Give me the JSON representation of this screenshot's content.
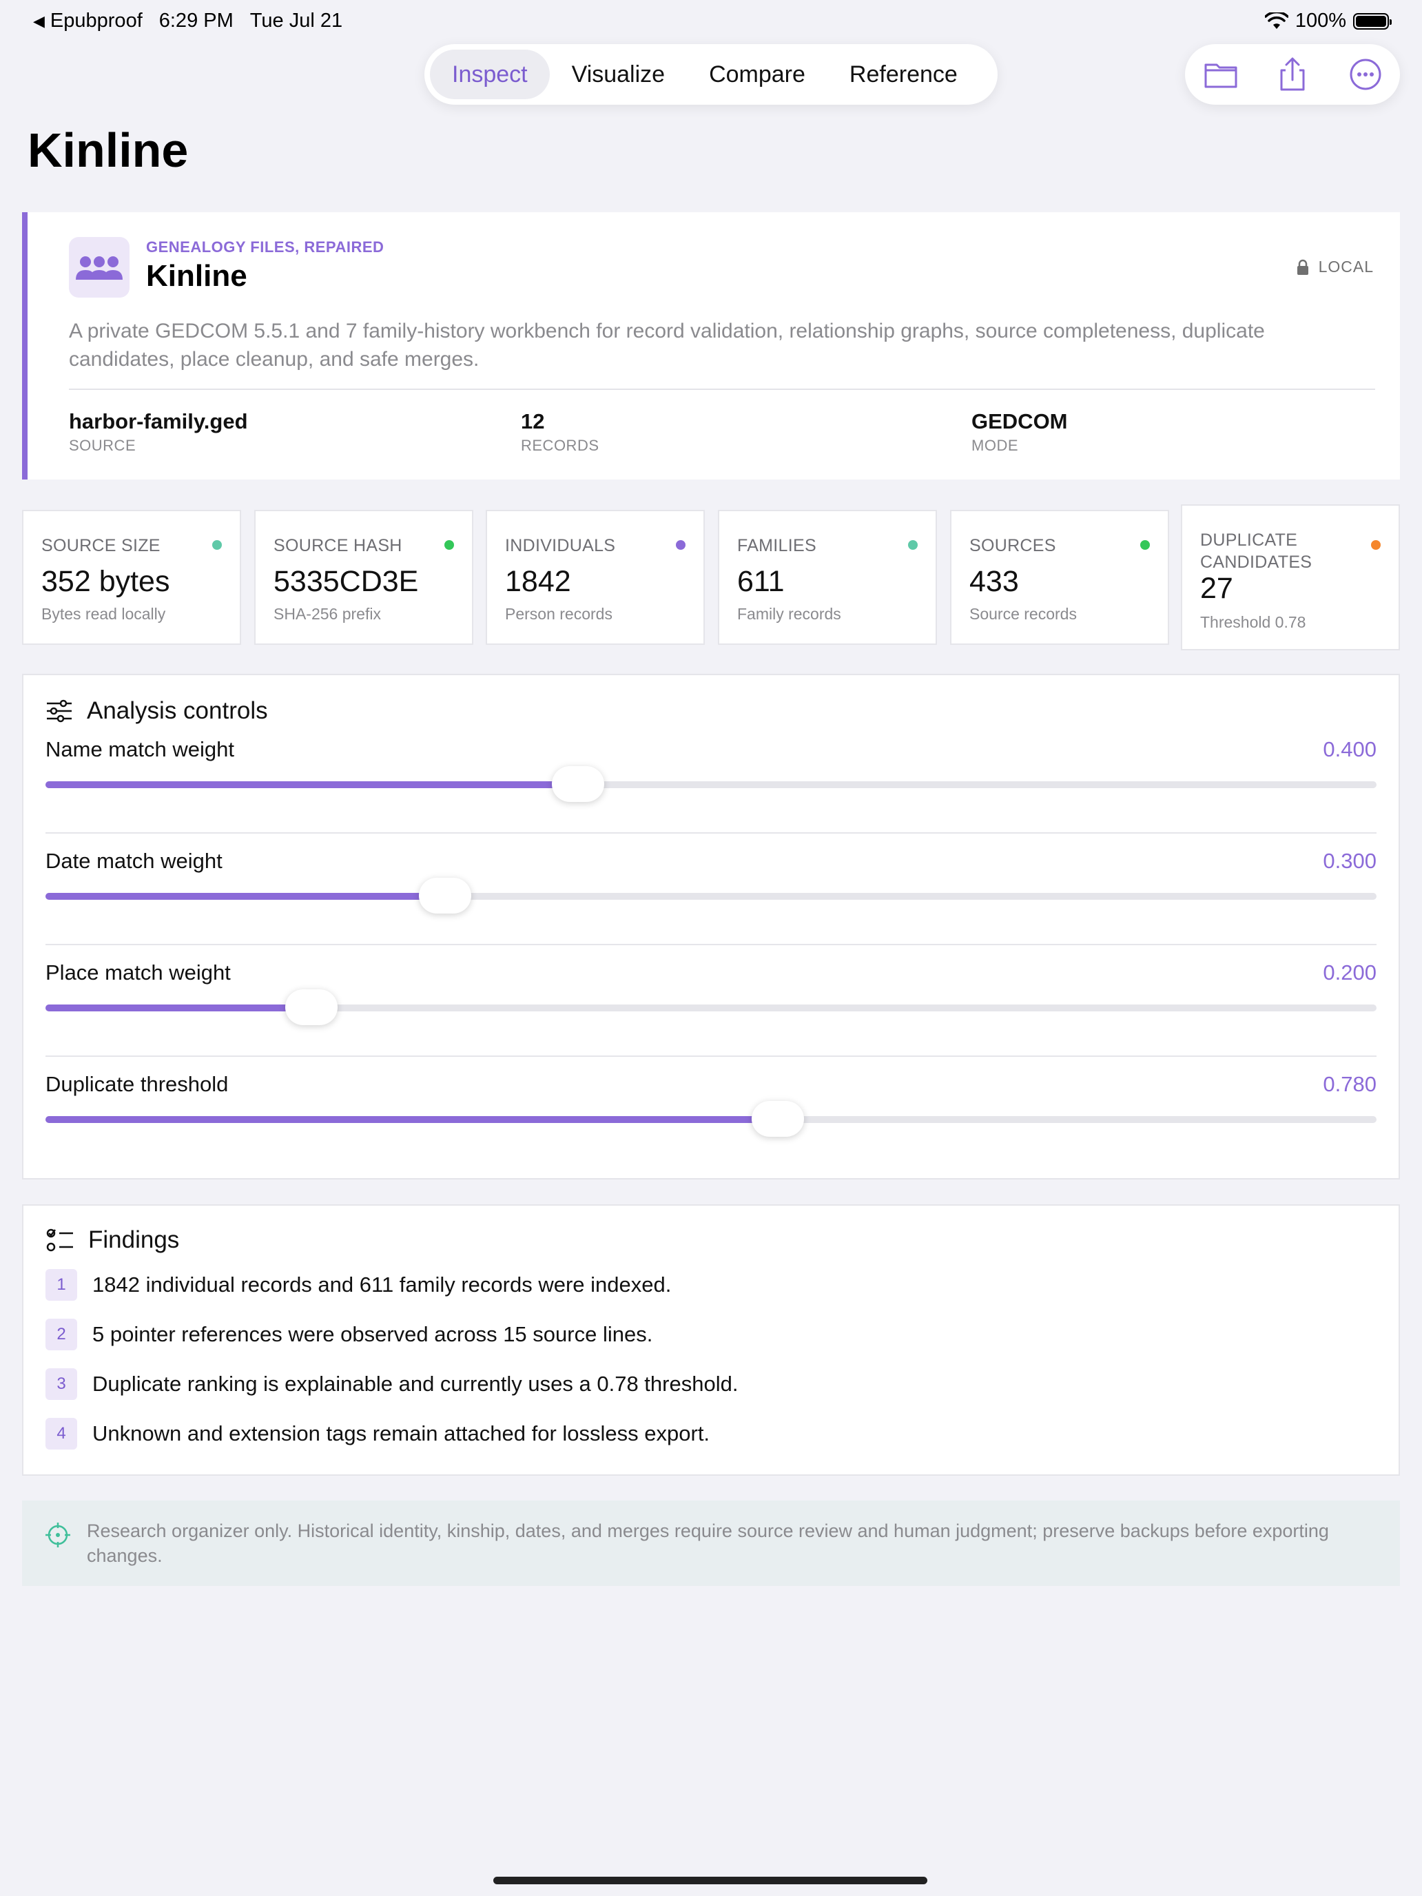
{
  "status_bar": {
    "back_app": "Epubproof",
    "time": "6:29 PM",
    "date": "Tue Jul 21",
    "battery": "100%"
  },
  "tabs": [
    {
      "label": "Inspect",
      "active": true
    },
    {
      "label": "Visualize",
      "active": false
    },
    {
      "label": "Compare",
      "active": false
    },
    {
      "label": "Reference",
      "active": false
    }
  ],
  "toolbar": {
    "icons": [
      "folder-icon",
      "share-icon",
      "more-icon"
    ]
  },
  "page_title": "Kinline",
  "hero": {
    "eyebrow": "GENEALOGY FILES, REPAIRED",
    "title": "Kinline",
    "badge": "LOCAL",
    "description": "A private GEDCOM 5.5.1 and 7 family-history workbench for record validation, relationship graphs, source completeness, duplicate candidates, place cleanup, and safe merges.",
    "meta": [
      {
        "value": "harbor-family.ged",
        "label": "SOURCE"
      },
      {
        "value": "12",
        "label": "RECORDS"
      },
      {
        "value": "GEDCOM",
        "label": "MODE"
      }
    ]
  },
  "stats": [
    {
      "label": "SOURCE SIZE",
      "value": "352 bytes",
      "sub": "Bytes read locally",
      "dot": "#5fc9a8"
    },
    {
      "label": "SOURCE HASH",
      "value": "5335CD3E",
      "sub": "SHA-256 prefix",
      "dot": "#34c759"
    },
    {
      "label": "INDIVIDUALS",
      "value": "1842",
      "sub": "Person records",
      "dot": "#8b6ad8"
    },
    {
      "label": "FAMILIES",
      "value": "611",
      "sub": "Family records",
      "dot": "#5fc9a8"
    },
    {
      "label": "SOURCES",
      "value": "433",
      "sub": "Source records",
      "dot": "#34c759"
    },
    {
      "label": "DUPLICATE CANDIDATES",
      "value": "27",
      "sub": "Threshold 0.78",
      "dot": "#f5862c"
    }
  ],
  "analysis": {
    "title": "Analysis controls",
    "sliders": [
      {
        "label": "Name match weight",
        "value_text": "0.400",
        "fraction": 0.4
      },
      {
        "label": "Date match weight",
        "value_text": "0.300",
        "fraction": 0.3
      },
      {
        "label": "Place match weight",
        "value_text": "0.200",
        "fraction": 0.2
      },
      {
        "label": "Duplicate threshold",
        "value_text": "0.780",
        "fraction": 0.55
      }
    ]
  },
  "findings": {
    "title": "Findings",
    "items": [
      {
        "n": "1",
        "text": "1842 individual records and 611 family records were indexed."
      },
      {
        "n": "2",
        "text": "5 pointer references were observed across 15 source lines."
      },
      {
        "n": "3",
        "text": "Duplicate ranking is explainable and currently uses a 0.78 threshold."
      },
      {
        "n": "4",
        "text": "Unknown and extension tags remain attached for lossless export."
      }
    ]
  },
  "disclaimer": "Research organizer only. Historical identity, kinship, dates, and merges require source review and human judgment; preserve backups before exporting changes.",
  "colors": {
    "accent": "#8b6ad8",
    "background": "#f2f2f7"
  }
}
